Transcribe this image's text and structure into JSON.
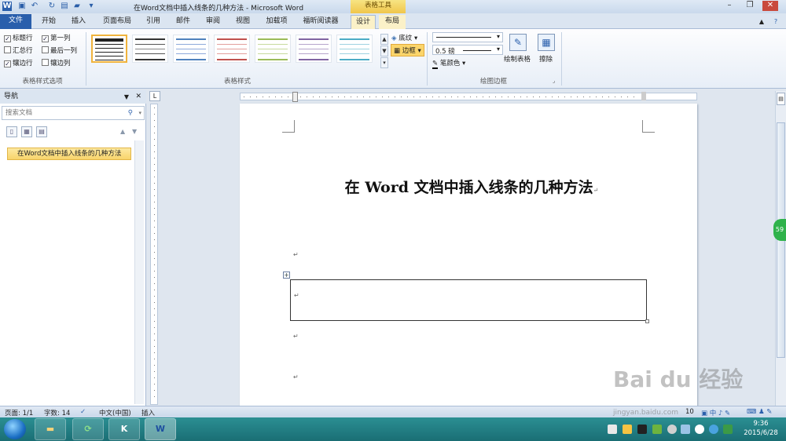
{
  "window": {
    "title": "在Word文档中插入线条的几种方法 - Microsoft Word",
    "contextual_tab_group": "表格工具"
  },
  "tabs": [
    {
      "label": "文件"
    },
    {
      "label": "开始"
    },
    {
      "label": "插入"
    },
    {
      "label": "页面布局"
    },
    {
      "label": "引用"
    },
    {
      "label": "邮件"
    },
    {
      "label": "审阅"
    },
    {
      "label": "视图"
    },
    {
      "label": "加载项"
    },
    {
      "label": "福昕阅读器"
    },
    {
      "label": "设计"
    },
    {
      "label": "布局"
    }
  ],
  "ribbon": {
    "style_options": {
      "label": "表格样式选项",
      "items": [
        {
          "label": "标题行",
          "checked": true
        },
        {
          "label": "第一列",
          "checked": true
        },
        {
          "label": "汇总行",
          "checked": false
        },
        {
          "label": "最后一列",
          "checked": false
        },
        {
          "label": "镶边行",
          "checked": true
        },
        {
          "label": "镶边列",
          "checked": false
        }
      ]
    },
    "table_styles": {
      "label": "表格样式"
    },
    "shading_label": "底纹",
    "borders_label": "边框",
    "pen_weight": "0.5 磅",
    "pen_color_label": "笔颜色",
    "draw_table_label": "绘制表格",
    "eraser_label": "擦除",
    "draw_borders": {
      "label": "绘图边框"
    }
  },
  "nav": {
    "title": "导航",
    "search_placeholder": "搜索文档",
    "heading_item": "在Word文档中插入线条的几种方法"
  },
  "document": {
    "title": "在 Word 文档中插入线条的几种方法",
    "para_mark": "↵"
  },
  "status": {
    "page": "页面: 1/1",
    "words": "字数: 14",
    "language": "中文(中国)",
    "mode": "插入",
    "zoom": "10"
  },
  "taskbar": {
    "time": "9:36",
    "date": "2015/6/28"
  },
  "watermark": {
    "brand": "Bai du 经验",
    "url": "jingyan.baidu.com"
  },
  "side_badge": "59"
}
